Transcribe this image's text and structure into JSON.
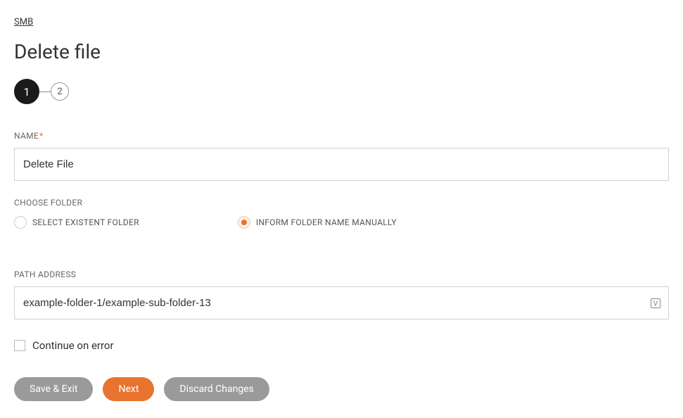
{
  "breadcrumb": "SMB",
  "title": "Delete file",
  "stepper": {
    "current": "1",
    "next": "2"
  },
  "fields": {
    "name": {
      "label": "NAME",
      "value": "Delete File"
    },
    "choose_folder": {
      "label": "CHOOSE FOLDER",
      "options": [
        {
          "label": "SELECT EXISTENT FOLDER",
          "selected": false
        },
        {
          "label": "INFORM FOLDER NAME MANUALLY",
          "selected": true
        }
      ]
    },
    "path_address": {
      "label": "PATH ADDRESS",
      "value": "example-folder-1/example-sub-folder-13"
    },
    "continue_on_error": {
      "label": "Continue on error",
      "checked": false
    }
  },
  "buttons": {
    "save_exit": "Save & Exit",
    "next": "Next",
    "discard": "Discard Changes"
  }
}
